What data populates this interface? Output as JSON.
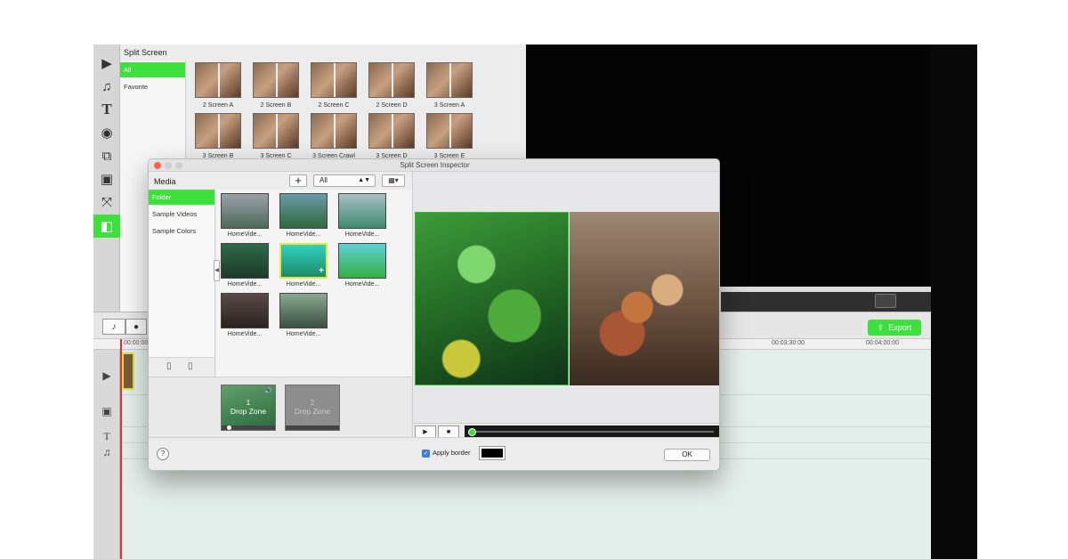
{
  "effects_panel": {
    "title": "Split Screen",
    "categories": [
      "All",
      "Favorite"
    ],
    "items": [
      {
        "label": "2 Screen A"
      },
      {
        "label": "2 Screen B"
      },
      {
        "label": "2 Screen C"
      },
      {
        "label": "2 Screen D"
      },
      {
        "label": "3 Screen A"
      },
      {
        "label": "3 Screen B"
      },
      {
        "label": "3 Screen C"
      },
      {
        "label": "3 Screen Crawl"
      },
      {
        "label": "3 Screen D"
      },
      {
        "label": "3 Screen E"
      }
    ]
  },
  "timeline": {
    "export_label": "Export",
    "ruler_labels": [
      "00:00:00",
      "00:03:30:00",
      "00:04:00:00"
    ]
  },
  "dialog": {
    "title": "Split Screen Inspector",
    "media_header": "Media",
    "add_symbol": "+",
    "filter_value": "All",
    "sidebar_items": [
      "Folder",
      "Sample Videos",
      "Sample Colors"
    ],
    "media_items": [
      {
        "name": "HomeVide...",
        "colors": [
          "#9aa0a8",
          "#4d6a5a"
        ]
      },
      {
        "name": "HomeVide...",
        "colors": [
          "#6a9aa8",
          "#2e6a3c"
        ]
      },
      {
        "name": "HomeVide...",
        "colors": [
          "#a8c0c4",
          "#3f8a70"
        ]
      },
      {
        "name": "HomeVide...",
        "colors": [
          "#2f6a4a",
          "#1c3a2a"
        ]
      },
      {
        "name": "HomeVide...",
        "colors": [
          "#2fd0c0",
          "#1f8a6a"
        ]
      },
      {
        "name": "HomeVide...",
        "colors": [
          "#5fd0d8",
          "#36b040"
        ]
      },
      {
        "name": "HomeVide...",
        "colors": [
          "#5a4a48",
          "#2a2422"
        ]
      },
      {
        "name": "HomeVide...",
        "colors": [
          "#8aa890",
          "#3a5042"
        ]
      }
    ],
    "dropzones": [
      {
        "number": "1",
        "label": "Drop Zone"
      },
      {
        "number": "2",
        "label": "Drop Zone"
      }
    ],
    "apply_border_label": "Apply border",
    "ok_label": "OK",
    "help_symbol": "?"
  }
}
